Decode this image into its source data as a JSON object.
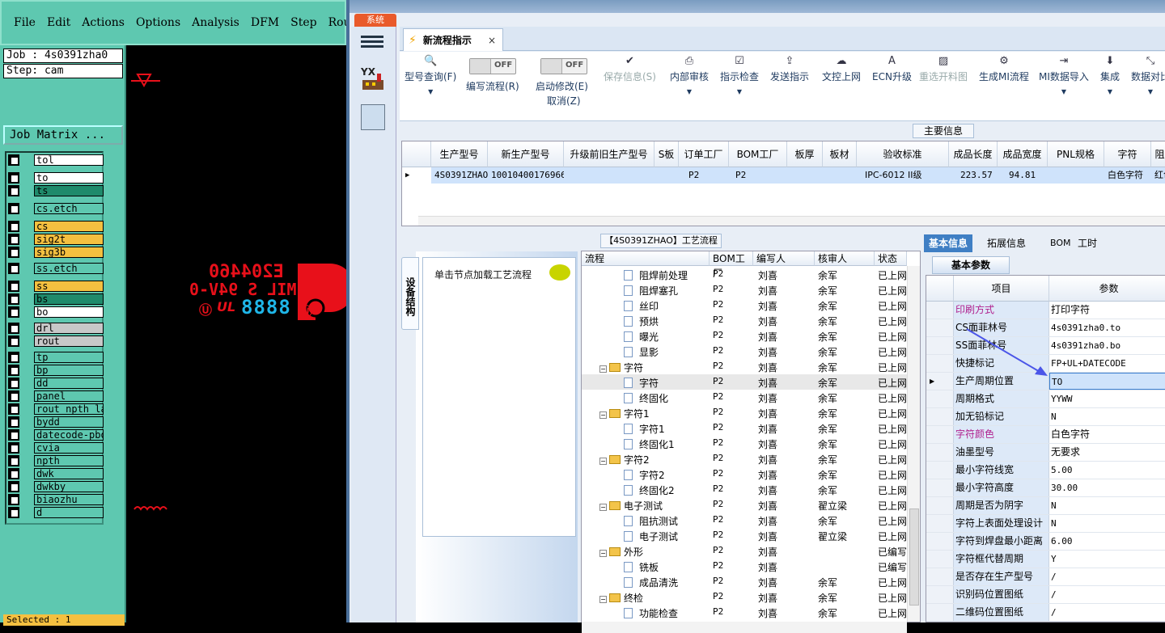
{
  "cam": {
    "menu": [
      "File",
      "Edit",
      "Actions",
      "Options",
      "Analysis",
      "DFM",
      "Step",
      "Rout"
    ],
    "job_label": "Job : 4s0391zha0",
    "step_label": "Step: cam",
    "job_matrix_button": "Job Matrix ...",
    "layers": [
      {
        "name": "tol",
        "color": "#ffffff"
      },
      {
        "name": "to",
        "color": "#ffffff"
      },
      {
        "name": "ts",
        "color": "#1f8a6b"
      },
      {
        "name": "cs.etch",
        "color": "#5ec8b0"
      },
      {
        "name": "cs",
        "color": "#f4c040"
      },
      {
        "name": "sig2t",
        "color": "#f4c040"
      },
      {
        "name": "sig3b",
        "color": "#f4c040"
      },
      {
        "name": "ss.etch",
        "color": "#5ec8b0"
      },
      {
        "name": "ss",
        "color": "#f4c040"
      },
      {
        "name": "bs",
        "color": "#1f8a6b"
      },
      {
        "name": "bo",
        "color": "#ffffff"
      },
      {
        "name": "drl",
        "color": "#c8c8c8"
      },
      {
        "name": "rout",
        "color": "#c8c8c8"
      },
      {
        "name": "tp",
        "color": "#5ec8b0"
      },
      {
        "name": "bp",
        "color": "#5ec8b0"
      },
      {
        "name": "dd",
        "color": "#5ec8b0"
      },
      {
        "name": "panel",
        "color": "#5ec8b0"
      },
      {
        "name": "rout_npth_la",
        "color": "#5ec8b0"
      },
      {
        "name": "bydd",
        "color": "#5ec8b0"
      },
      {
        "name": "datecode-pbo",
        "color": "#5ec8b0"
      },
      {
        "name": "cvia",
        "color": "#5ec8b0"
      },
      {
        "name": "npth",
        "color": "#5ec8b0"
      },
      {
        "name": "dwk",
        "color": "#5ec8b0"
      },
      {
        "name": "dwkby",
        "color": "#5ec8b0"
      },
      {
        "name": "biaozhu",
        "color": "#5ec8b0"
      },
      {
        "name": "d",
        "color": "#5ec8b0"
      }
    ],
    "selected_text": "Selected : 1",
    "canvas_text": {
      "line1": "E204460",
      "line2": "MIL S 94V-0",
      "code": "8888"
    }
  },
  "app": {
    "system_tab": "系统",
    "tab_title": "新流程指示",
    "toolbar": [
      {
        "label": "型号查询(F)",
        "icon": "search-icon",
        "enabled": true
      },
      {
        "label": "编写流程(R)",
        "toggle": "OFF",
        "enabled": true
      },
      {
        "label": "启动修改(E)",
        "sub": "取消(Z)",
        "toggle": "OFF",
        "enabled": true
      },
      {
        "label": "保存信息(S)",
        "icon": "check-icon",
        "enabled": false
      },
      {
        "label": "内部审核",
        "icon": "print-icon",
        "enabled": true
      },
      {
        "label": "指示检查",
        "icon": "checkbox-icon",
        "enabled": true
      },
      {
        "label": "发送指示",
        "icon": "upload-icon",
        "enabled": true
      },
      {
        "label": "文控上网",
        "icon": "cloud-upload-icon",
        "enabled": true
      },
      {
        "label": "ECN升级",
        "icon": "a-icon",
        "enabled": true
      },
      {
        "label": "重选开料图",
        "icon": "image-icon",
        "enabled": false
      },
      {
        "label": "生成MI流程",
        "icon": "gears-icon",
        "enabled": true
      },
      {
        "label": "MI数据导入",
        "icon": "import-icon",
        "enabled": true
      },
      {
        "label": "集成",
        "icon": "download-icon",
        "enabled": true
      },
      {
        "label": "数据对比",
        "icon": "compare-icon",
        "enabled": true
      }
    ],
    "main_info_title": "主要信息",
    "main_grid": {
      "headers": [
        "生产型号",
        "新生产型号",
        "升级前旧生产型号",
        "S板",
        "订单工厂",
        "BOM工厂",
        "板厚",
        "板材",
        "验收标准",
        "成品长度",
        "成品宽度",
        "PNL规格",
        "字符",
        "阻"
      ],
      "row": [
        "4S0391ZHAO",
        "10010400176966",
        "",
        "",
        "P2",
        "P2",
        "",
        "",
        "IPC-6012 II级",
        "223.57",
        "94.81",
        "",
        "白色字符",
        "红色"
      ]
    },
    "flow_title": "【4S0391ZHAO】工艺流程",
    "node_vtab": "设备结构",
    "node_hint": "单击节点加载工艺流程",
    "tree_headers": [
      "流程",
      "BOM工厂",
      "编写人",
      "核审人",
      "状态"
    ],
    "tree_rows": [
      {
        "level": 2,
        "type": "doc",
        "name": "阻焊前处理",
        "bom": "P2",
        "writer": "刘喜",
        "reviewer": "余军",
        "status": "已上网"
      },
      {
        "level": 2,
        "type": "doc",
        "name": "阻焊塞孔",
        "bom": "P2",
        "writer": "刘喜",
        "reviewer": "余军",
        "status": "已上网"
      },
      {
        "level": 2,
        "type": "doc",
        "name": "丝印",
        "bom": "P2",
        "writer": "刘喜",
        "reviewer": "余军",
        "status": "已上网"
      },
      {
        "level": 2,
        "type": "doc",
        "name": "预烘",
        "bom": "P2",
        "writer": "刘喜",
        "reviewer": "余军",
        "status": "已上网"
      },
      {
        "level": 2,
        "type": "doc",
        "name": "曝光",
        "bom": "P2",
        "writer": "刘喜",
        "reviewer": "余军",
        "status": "已上网"
      },
      {
        "level": 2,
        "type": "doc",
        "name": "显影",
        "bom": "P2",
        "writer": "刘喜",
        "reviewer": "余军",
        "status": "已上网"
      },
      {
        "level": 1,
        "type": "folder",
        "name": "字符",
        "bom": "P2",
        "writer": "刘喜",
        "reviewer": "余军",
        "status": "已上网"
      },
      {
        "level": 2,
        "type": "doc",
        "name": "字符",
        "bom": "P2",
        "writer": "刘喜",
        "reviewer": "余军",
        "status": "已上网",
        "selected": true
      },
      {
        "level": 2,
        "type": "doc",
        "name": "终固化",
        "bom": "P2",
        "writer": "刘喜",
        "reviewer": "余军",
        "status": "已上网"
      },
      {
        "level": 1,
        "type": "folder",
        "name": "字符1",
        "bom": "P2",
        "writer": "刘喜",
        "reviewer": "余军",
        "status": "已上网"
      },
      {
        "level": 2,
        "type": "doc",
        "name": "字符1",
        "bom": "P2",
        "writer": "刘喜",
        "reviewer": "余军",
        "status": "已上网"
      },
      {
        "level": 2,
        "type": "doc",
        "name": "终固化1",
        "bom": "P2",
        "writer": "刘喜",
        "reviewer": "余军",
        "status": "已上网"
      },
      {
        "level": 1,
        "type": "folder",
        "name": "字符2",
        "bom": "P2",
        "writer": "刘喜",
        "reviewer": "余军",
        "status": "已上网"
      },
      {
        "level": 2,
        "type": "doc",
        "name": "字符2",
        "bom": "P2",
        "writer": "刘喜",
        "reviewer": "余军",
        "status": "已上网"
      },
      {
        "level": 2,
        "type": "doc",
        "name": "终固化2",
        "bom": "P2",
        "writer": "刘喜",
        "reviewer": "余军",
        "status": "已上网"
      },
      {
        "level": 1,
        "type": "folder",
        "name": "电子测试",
        "bom": "P2",
        "writer": "刘喜",
        "reviewer": "翟立梁",
        "status": "已上网"
      },
      {
        "level": 2,
        "type": "doc",
        "name": "阻抗测试",
        "bom": "P2",
        "writer": "刘喜",
        "reviewer": "余军",
        "status": "已上网"
      },
      {
        "level": 2,
        "type": "doc",
        "name": "电子测试",
        "bom": "P2",
        "writer": "刘喜",
        "reviewer": "翟立梁",
        "status": "已上网"
      },
      {
        "level": 1,
        "type": "folder",
        "name": "外形",
        "bom": "P2",
        "writer": "刘喜",
        "reviewer": "",
        "status": "已编写"
      },
      {
        "level": 2,
        "type": "doc",
        "name": "铣板",
        "bom": "P2",
        "writer": "刘喜",
        "reviewer": "",
        "status": "已编写"
      },
      {
        "level": 2,
        "type": "doc",
        "name": "成品清洗",
        "bom": "P2",
        "writer": "刘喜",
        "reviewer": "余军",
        "status": "已上网"
      },
      {
        "level": 1,
        "type": "folder",
        "name": "终检",
        "bom": "P2",
        "writer": "刘喜",
        "reviewer": "余军",
        "status": "已上网"
      },
      {
        "level": 2,
        "type": "doc",
        "name": "功能检查",
        "bom": "P2",
        "writer": "刘喜",
        "reviewer": "余军",
        "status": "已上网"
      }
    ],
    "prop_tabs": [
      "基本信息",
      "拓展信息",
      "BOM",
      "工时"
    ],
    "prop_subtab": "基本参数",
    "prop_headers": [
      "项目",
      "参数"
    ],
    "prop_rows": [
      {
        "key": "印刷方式",
        "value": "打印字符",
        "pink": true
      },
      {
        "key": "CS面菲林号",
        "value": "4s0391zha0.to"
      },
      {
        "key": "SS面菲林号",
        "value": "4s0391zha0.bo"
      },
      {
        "key": "快捷标记",
        "value": "FP+UL+DATECODE"
      },
      {
        "key": "生产周期位置",
        "value": "TO",
        "selected": true
      },
      {
        "key": "周期格式",
        "value": "YYWW"
      },
      {
        "key": "加无铅标记",
        "value": "N"
      },
      {
        "key": "字符颜色",
        "value": "白色字符",
        "pink": true
      },
      {
        "key": "油墨型号",
        "value": "无要求"
      },
      {
        "key": "最小字符线宽",
        "value": "5.00"
      },
      {
        "key": "最小字符高度",
        "value": "30.00"
      },
      {
        "key": "周期是否为阴字",
        "value": "N"
      },
      {
        "key": "字符上表面处理设计",
        "value": "N"
      },
      {
        "key": "字符到焊盘最小距离",
        "value": "6.00"
      },
      {
        "key": "字符框代替周期",
        "value": "Y"
      },
      {
        "key": "是否存在生产型号",
        "value": "/"
      },
      {
        "key": "识别码位置图纸",
        "value": "/"
      },
      {
        "key": "二维码位置图纸",
        "value": "/"
      }
    ]
  }
}
